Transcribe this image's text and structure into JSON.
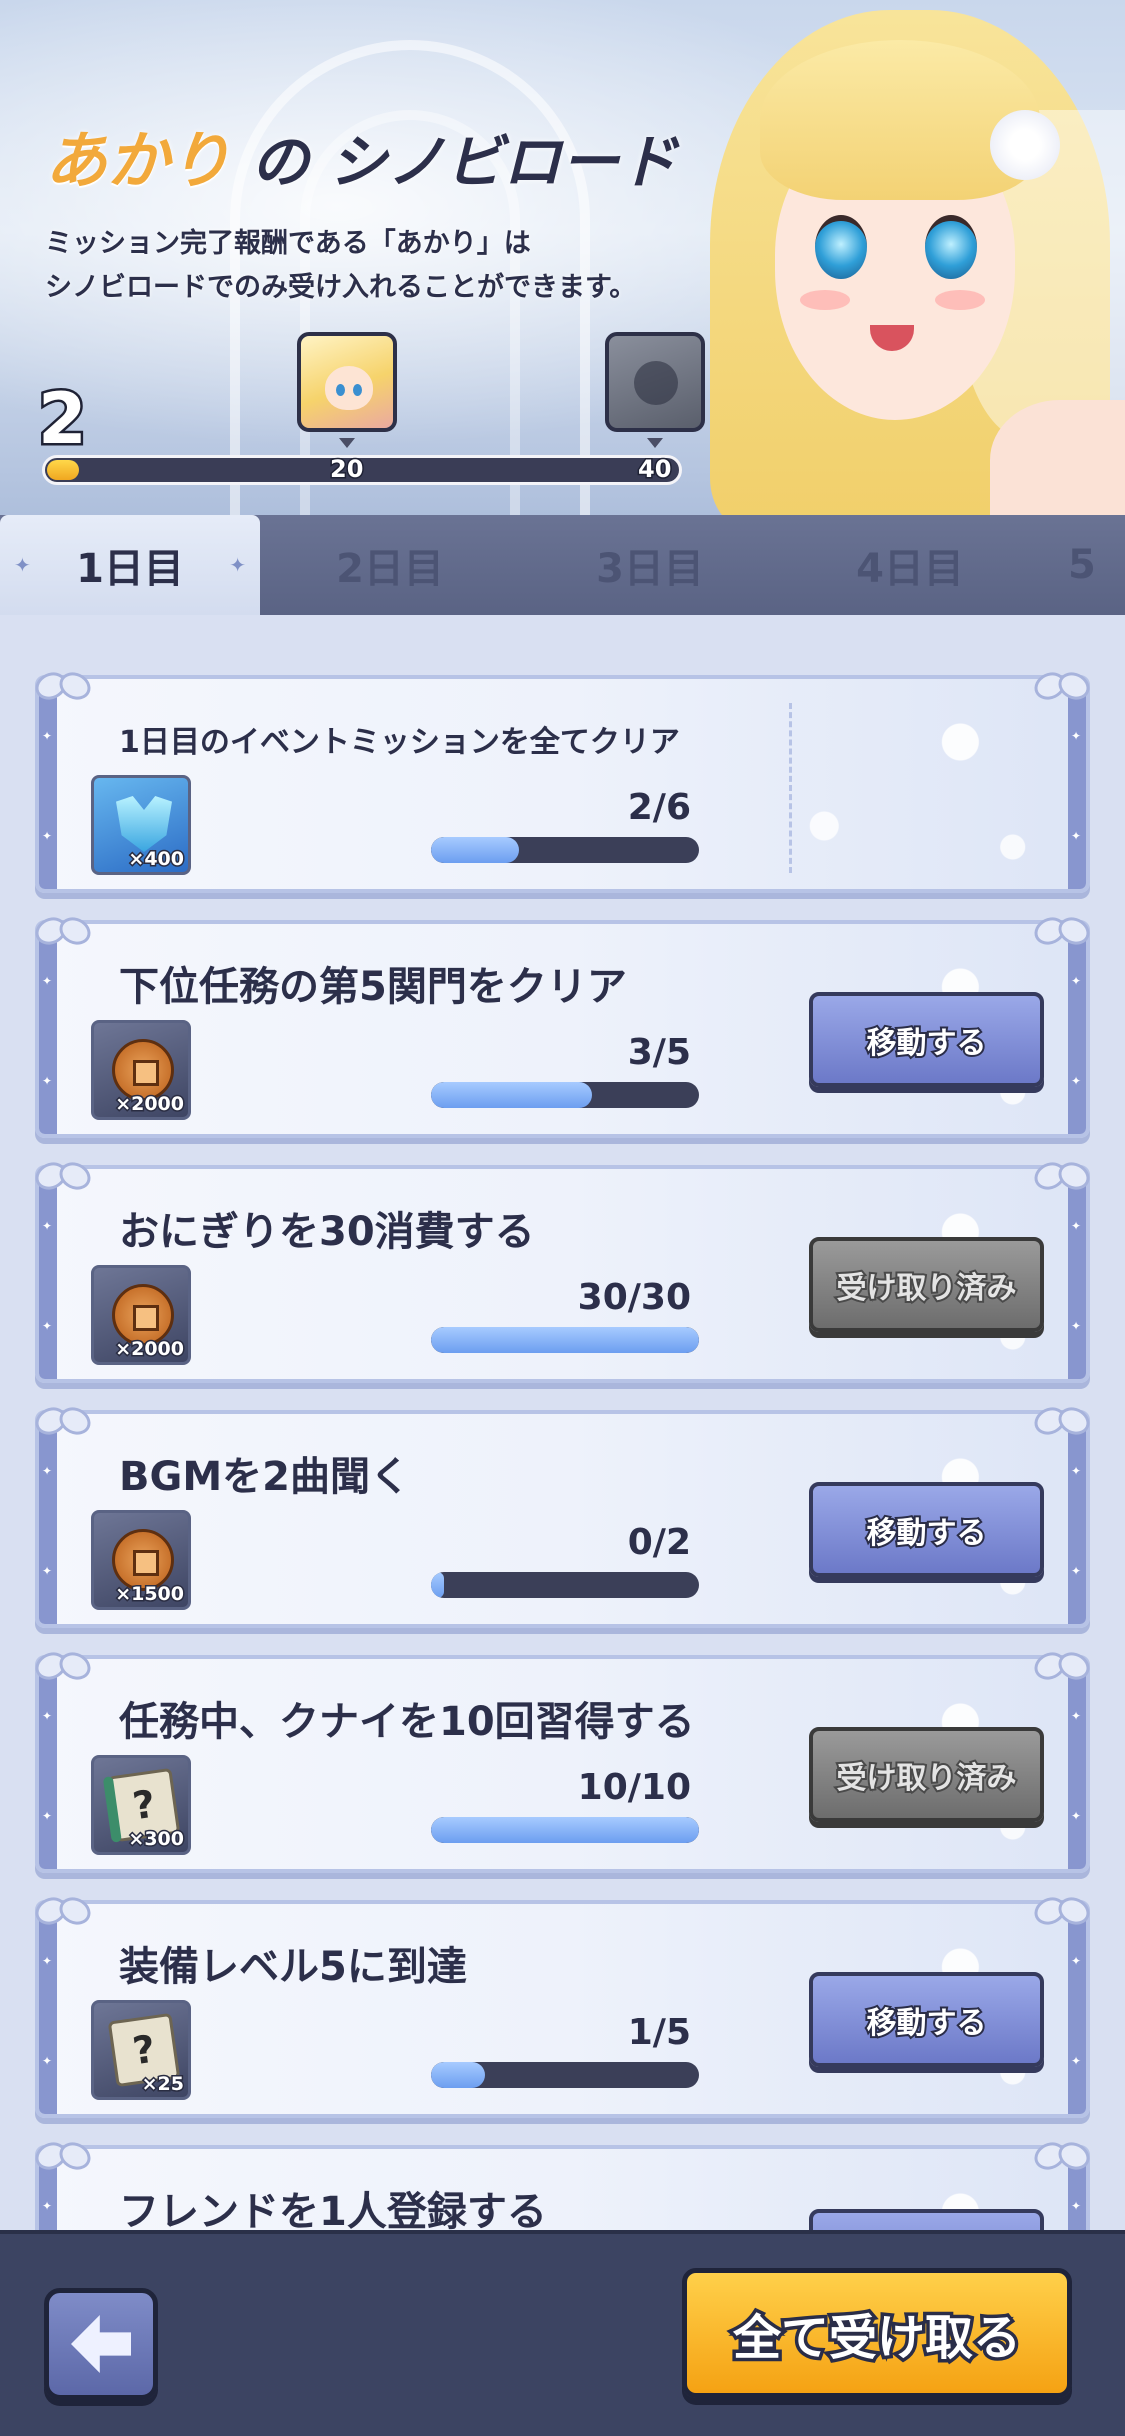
{
  "header": {
    "title_name": "あかり",
    "title_particle": "の",
    "title_rest": "シノビロード",
    "description_line1": "ミッション完了報酬である「あかり」は",
    "description_line2": "シノビロードでのみ受け入れることができます。",
    "level": "2",
    "progress_percent": 5,
    "milestones": [
      "20",
      "40"
    ]
  },
  "tabs": [
    {
      "label": "1日目",
      "active": true
    },
    {
      "label": "2日目",
      "active": false
    },
    {
      "label": "3日目",
      "active": false
    },
    {
      "label": "4日目",
      "active": false
    },
    {
      "label": "5",
      "active": false
    }
  ],
  "missions": [
    {
      "title": "1日目のイベントミッションを全てクリア",
      "reward_icon": "gem-icon",
      "reward_qty": "×400",
      "count": "2/6",
      "progress": 0.33,
      "button": ""
    },
    {
      "title": "下位任務の第5関門をクリア",
      "reward_icon": "coin-icon",
      "reward_qty": "×2000",
      "count": "3/5",
      "progress": 0.6,
      "button": "移動する",
      "button_state": "go"
    },
    {
      "title": "おにぎりを30消費する",
      "reward_icon": "coin-icon",
      "reward_qty": "×2000",
      "count": "30/30",
      "progress": 1.0,
      "button": "受け取り済み",
      "button_state": "done"
    },
    {
      "title": "BGMを2曲聞く",
      "reward_icon": "coin-icon",
      "reward_qty": "×1500",
      "count": "0/2",
      "progress": 0.05,
      "button": "移動する",
      "button_state": "go"
    },
    {
      "title": "任務中、クナイを10回習得する",
      "reward_icon": "scroll-icon",
      "reward_qty": "×300",
      "count": "10/10",
      "progress": 1.0,
      "button": "受け取り済み",
      "button_state": "done"
    },
    {
      "title": "装備レベル5に到達",
      "reward_icon": "scroll-icon",
      "reward_qty": "×25",
      "count": "1/5",
      "progress": 0.2,
      "button": "移動する",
      "button_state": "go"
    },
    {
      "title": "フレンドを1人登録する"
    }
  ],
  "footer": {
    "claim_all_label": "全て受け取る"
  }
}
